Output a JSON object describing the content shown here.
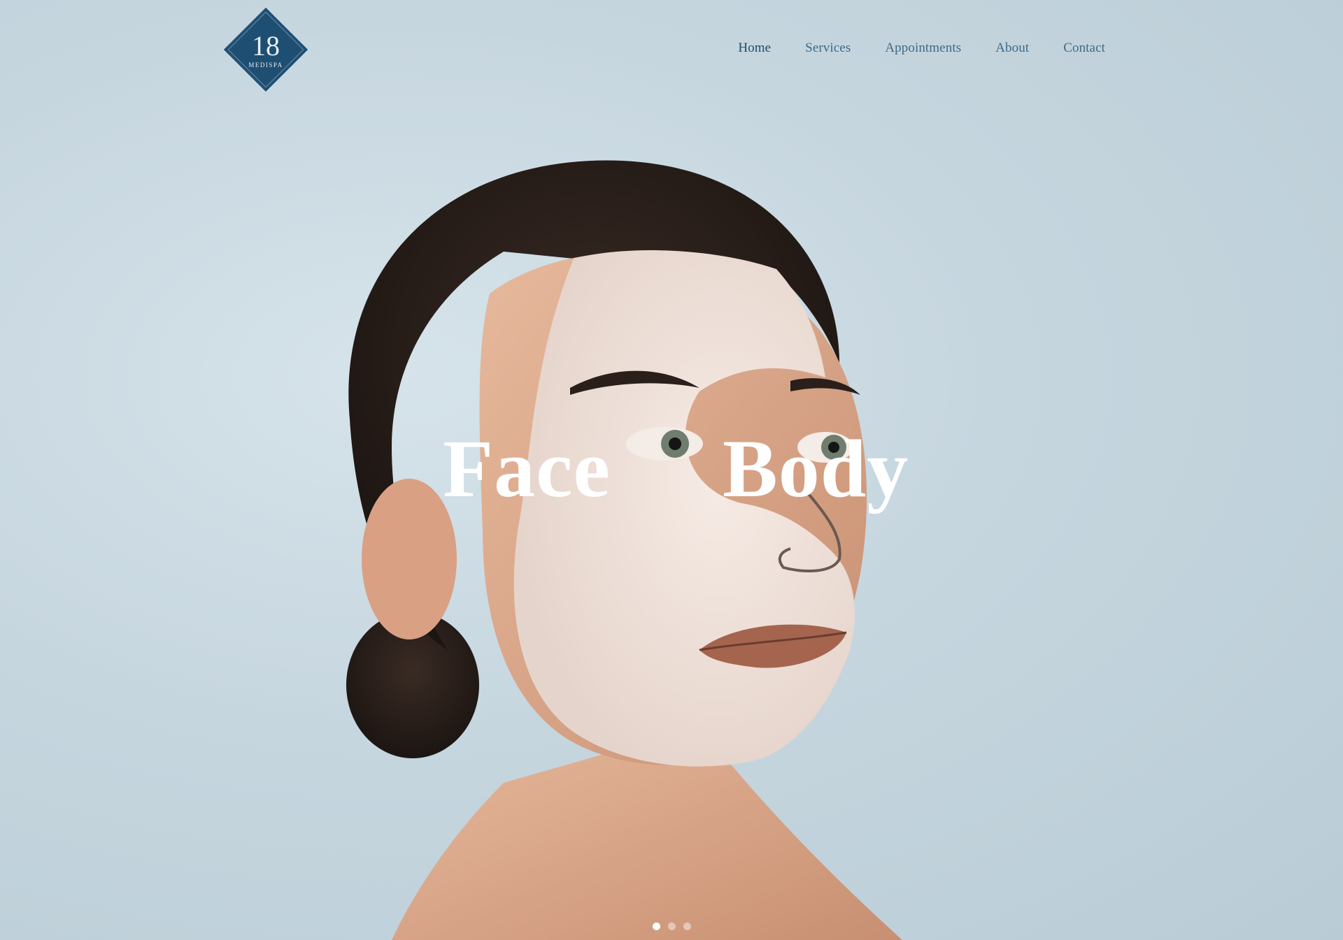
{
  "brand": {
    "logo_number": "18",
    "logo_text": "MEDISPA",
    "logo_color": "#1e4f73"
  },
  "nav": {
    "items": [
      {
        "label": "Home",
        "active": true
      },
      {
        "label": "Services",
        "active": false
      },
      {
        "label": "Appointments",
        "active": false
      },
      {
        "label": "About",
        "active": false
      },
      {
        "label": "Contact",
        "active": false
      }
    ]
  },
  "hero": {
    "title_left": "Face",
    "title_right": "Body",
    "image": "woman-face-mask-portrait",
    "slides_count": 3,
    "active_slide": 1
  },
  "colors": {
    "background": "#c6d6df",
    "nav_text": "#3f6a86",
    "nav_active": "#1f4d6b",
    "hero_text": "#ffffff"
  }
}
